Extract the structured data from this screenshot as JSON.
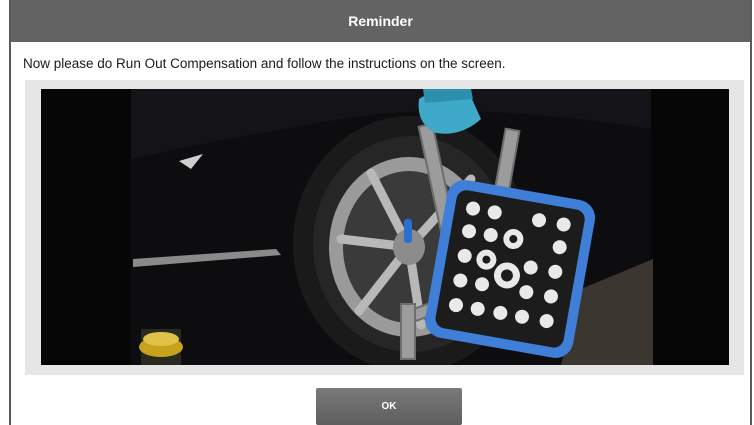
{
  "dialog": {
    "title": "Reminder",
    "message": "Now please do Run Out Compensation and follow the instructions on the screen.",
    "ok_label": "OK"
  },
  "media": {
    "subject": "wheel-clamp-target-photo"
  },
  "colors": {
    "titlebar": "#636363",
    "target_frame": "#3f7fd8",
    "button": "#666666"
  }
}
